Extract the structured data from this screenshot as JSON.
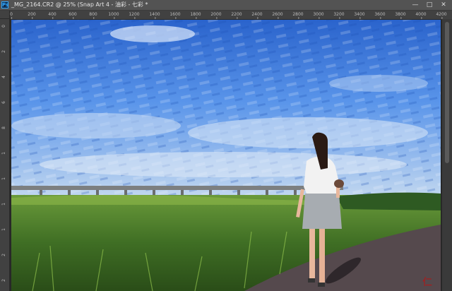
{
  "window": {
    "app_icon": "photoshop-icon",
    "title": "_MG_2164.CR2 @ 25% (Snap Art 4 - 油彩 - 七彩 *",
    "buttons": {
      "minimize": "—",
      "maximize": "□",
      "close": "✕"
    }
  },
  "ruler": {
    "horizontal": [
      "0",
      "200",
      "400",
      "600",
      "800",
      "1000",
      "1200",
      "1400",
      "1600",
      "1800",
      "2000",
      "2200",
      "2400",
      "2600",
      "2800",
      "3000",
      "3200",
      "3400",
      "3600",
      "3800",
      "4000",
      "4200"
    ],
    "vertical": [
      "0",
      "2",
      "4",
      "6",
      "8",
      "1",
      "1",
      "1",
      "1",
      "2",
      "2"
    ]
  },
  "canvas": {
    "image_alt": "Oil-painting style photo: girl in white shirt and grey skirt walking on a path beside a grassy riverbank under a blue cloudy sky, bridge in distance",
    "colors": {
      "sky_top": "#2f6fd8",
      "sky_mid": "#5f9cf0",
      "sky_low": "#a9c9ef",
      "grass_dark": "#2f5a1e",
      "grass_light": "#7fae3a",
      "path": "#5b4f52",
      "shirt": "#f3f3f3",
      "skirt": "#9ea3a8"
    }
  }
}
